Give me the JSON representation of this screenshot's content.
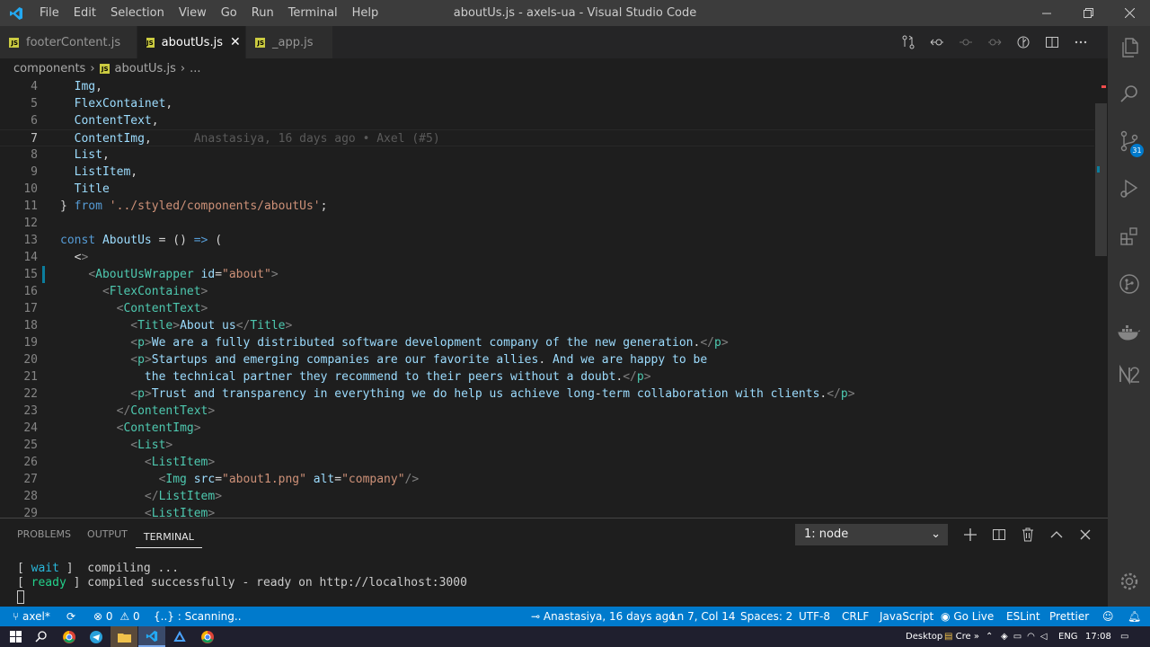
{
  "window": {
    "title": "aboutUs.js - axels-ua - Visual Studio Code",
    "menu": [
      "File",
      "Edit",
      "Selection",
      "View",
      "Go",
      "Run",
      "Terminal",
      "Help"
    ]
  },
  "tabs": [
    {
      "label": "footerContent.js",
      "active": false
    },
    {
      "label": "aboutUs.js",
      "active": true
    },
    {
      "label": "_app.js",
      "active": false
    }
  ],
  "tab_close_glyph": "✕",
  "file_icon_label": "JS",
  "breadcrumb": {
    "folder": "components",
    "file": "aboutUs.js",
    "more": "..."
  },
  "editor": {
    "current_line": 7,
    "blame": "Anastasiya, 16 days ago • Axel (#5)",
    "lines": [
      {
        "n": "4",
        "text": "  Img,"
      },
      {
        "n": "5",
        "text": "  FlexContainet,"
      },
      {
        "n": "6",
        "text": "  ContentText,"
      },
      {
        "n": "7",
        "text": "  ContentImg,"
      },
      {
        "n": "8",
        "text": "  List,"
      },
      {
        "n": "9",
        "text": "  ListItem,"
      },
      {
        "n": "10",
        "text": "  Title"
      },
      {
        "n": "11",
        "text": "} from '../styled/components/aboutUs';"
      },
      {
        "n": "12",
        "text": ""
      },
      {
        "n": "13",
        "text": "const AboutUs = () => ("
      },
      {
        "n": "14",
        "text": "  <>"
      },
      {
        "n": "15",
        "text": "    <AboutUsWrapper id=\"about\">"
      },
      {
        "n": "16",
        "text": "      <FlexContainet>"
      },
      {
        "n": "17",
        "text": "        <ContentText>"
      },
      {
        "n": "18",
        "text": "          <Title>About us</Title>"
      },
      {
        "n": "19",
        "text": "          <p>We are a fully distributed software development company of the new generation.</p>"
      },
      {
        "n": "20",
        "text": "          <p>Startups and emerging companies are our favorite allies. And we are happy to be"
      },
      {
        "n": "21",
        "text": "            the technical partner they recommend to their peers without a doubt.</p>"
      },
      {
        "n": "22",
        "text": "          <p>Trust and transparency in everything we do help us achieve long-term collaboration with clients.</p>"
      },
      {
        "n": "23",
        "text": "        </ContentText>"
      },
      {
        "n": "24",
        "text": "        <ContentImg>"
      },
      {
        "n": "25",
        "text": "          <List>"
      },
      {
        "n": "26",
        "text": "            <ListItem>"
      },
      {
        "n": "27",
        "text": "              <Img src=\"about1.png\" alt=\"company\"/>"
      },
      {
        "n": "28",
        "text": "            </ListItem>"
      },
      {
        "n": "29",
        "text": "            <ListItem>"
      }
    ]
  },
  "panel": {
    "tabs": [
      {
        "label": "PROBLEMS",
        "active": false
      },
      {
        "label": "OUTPUT",
        "active": false
      },
      {
        "label": "TERMINAL",
        "active": true
      }
    ],
    "terminal_selector": "1: node",
    "terminal": {
      "line1": {
        "open": "[ ",
        "tag": "wait",
        "close": " ]  compiling ..."
      },
      "line2": {
        "open": "[ ",
        "tag": "ready",
        "close": " ] compiled successfully - ready on http://localhost:3000"
      }
    }
  },
  "activity_bar": {
    "scm_badge": "31"
  },
  "status_bar": {
    "branch": "axel*",
    "errors": "0",
    "warnings": "0",
    "scanning": "{..} : Scanning..",
    "blame": "Anastasiya, 16 days ago",
    "position": "Ln 7, Col 14",
    "spaces": "Spaces: 2",
    "encoding": "UTF-8",
    "eol": "CRLF",
    "language": "JavaScript",
    "golive": "Go Live",
    "eslint": "ESLint",
    "prettier": "Prettier"
  },
  "taskbar": {
    "desktop_label": "Desktop",
    "cre_label": "Cre",
    "overflow_glyph": "»",
    "lang": "ENG",
    "time": "17:08"
  },
  "colors": {
    "accent": "#007acc",
    "titlebar": "#3c3c3c",
    "editor_bg": "#1e1e1e",
    "activitybar": "#333333"
  }
}
